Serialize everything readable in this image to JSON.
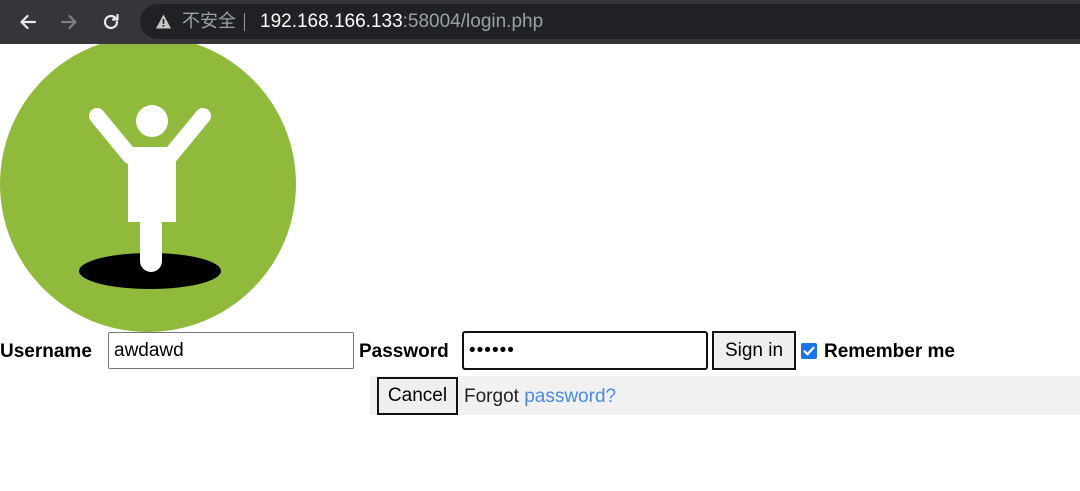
{
  "browser": {
    "back_icon": "arrow-left-icon",
    "forward_icon": "arrow-right-icon",
    "reload_icon": "reload-icon",
    "security_label": "不安全",
    "url_host": "192.168.166.133",
    "url_rest": ":58004/login.php",
    "security_icon": "warning-triangle-icon"
  },
  "logo": {
    "icon": "person-emerging-from-hole-icon",
    "circle_color": "#8fba3b"
  },
  "login": {
    "username_label": "Username",
    "username_value": "awdawd",
    "password_label": "Password",
    "password_value": "••••••",
    "sign_in_label": "Sign in",
    "remember_label": "Remember me",
    "remember_checked": true,
    "cancel_label": "Cancel",
    "forgot_prefix": "Forgot",
    "forgot_link": "password?"
  },
  "colors": {
    "link": "#4a8ae6",
    "checkbox": "#1a73e8"
  }
}
